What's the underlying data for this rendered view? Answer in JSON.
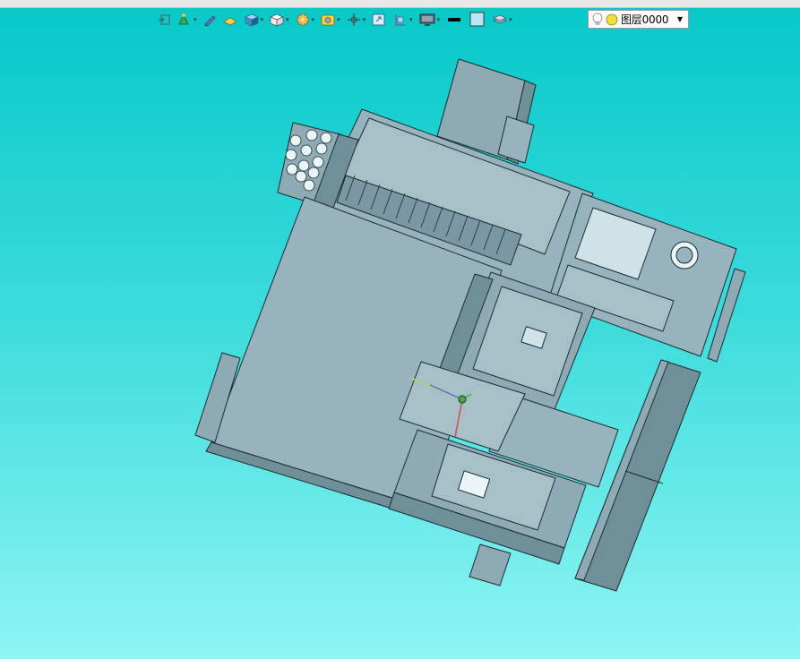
{
  "toolbar": {
    "buttons": [
      {
        "name": "view-frame-button",
        "icon": "frame-icon",
        "has_dropdown": false
      },
      {
        "name": "snap-button",
        "icon": "snap-icon",
        "has_dropdown": true
      },
      {
        "name": "pen-button",
        "icon": "pen-icon",
        "has_dropdown": false
      },
      {
        "name": "plane-button",
        "icon": "plane-icon",
        "has_dropdown": false
      },
      {
        "name": "shaded-cube-button",
        "icon": "shaded-cube-icon",
        "has_dropdown": true
      },
      {
        "name": "white-cube-button",
        "icon": "white-cube-icon",
        "has_dropdown": true
      },
      {
        "name": "render-style-button",
        "icon": "render-style-icon",
        "has_dropdown": true
      },
      {
        "name": "camera-button",
        "icon": "camera-icon",
        "has_dropdown": true
      },
      {
        "name": "axis-button",
        "icon": "axis-icon",
        "has_dropdown": true
      },
      {
        "name": "zoom-fit-button",
        "icon": "zoom-fit-icon",
        "has_dropdown": false
      },
      {
        "name": "section-button",
        "icon": "section-icon",
        "has_dropdown": true
      },
      {
        "name": "monitor-button",
        "icon": "monitor-icon",
        "has_dropdown": true
      },
      {
        "name": "line-color-button",
        "icon": "line-color-icon",
        "has_dropdown": false
      },
      {
        "name": "fill-color-button",
        "icon": "fill-color-icon",
        "has_dropdown": false
      },
      {
        "name": "layers-button",
        "icon": "layers-icon",
        "has_dropdown": true
      }
    ]
  },
  "layer_selector": {
    "icons": [
      "lightbulb-icon",
      "sun-icon"
    ],
    "text": "图层0000"
  },
  "colors": {
    "background_top": "#06c8c8",
    "background_bottom": "#8ef5f3",
    "model_fill": "#97b3bd",
    "model_dark": "#6f8f99",
    "model_edge": "#1c2a30"
  }
}
